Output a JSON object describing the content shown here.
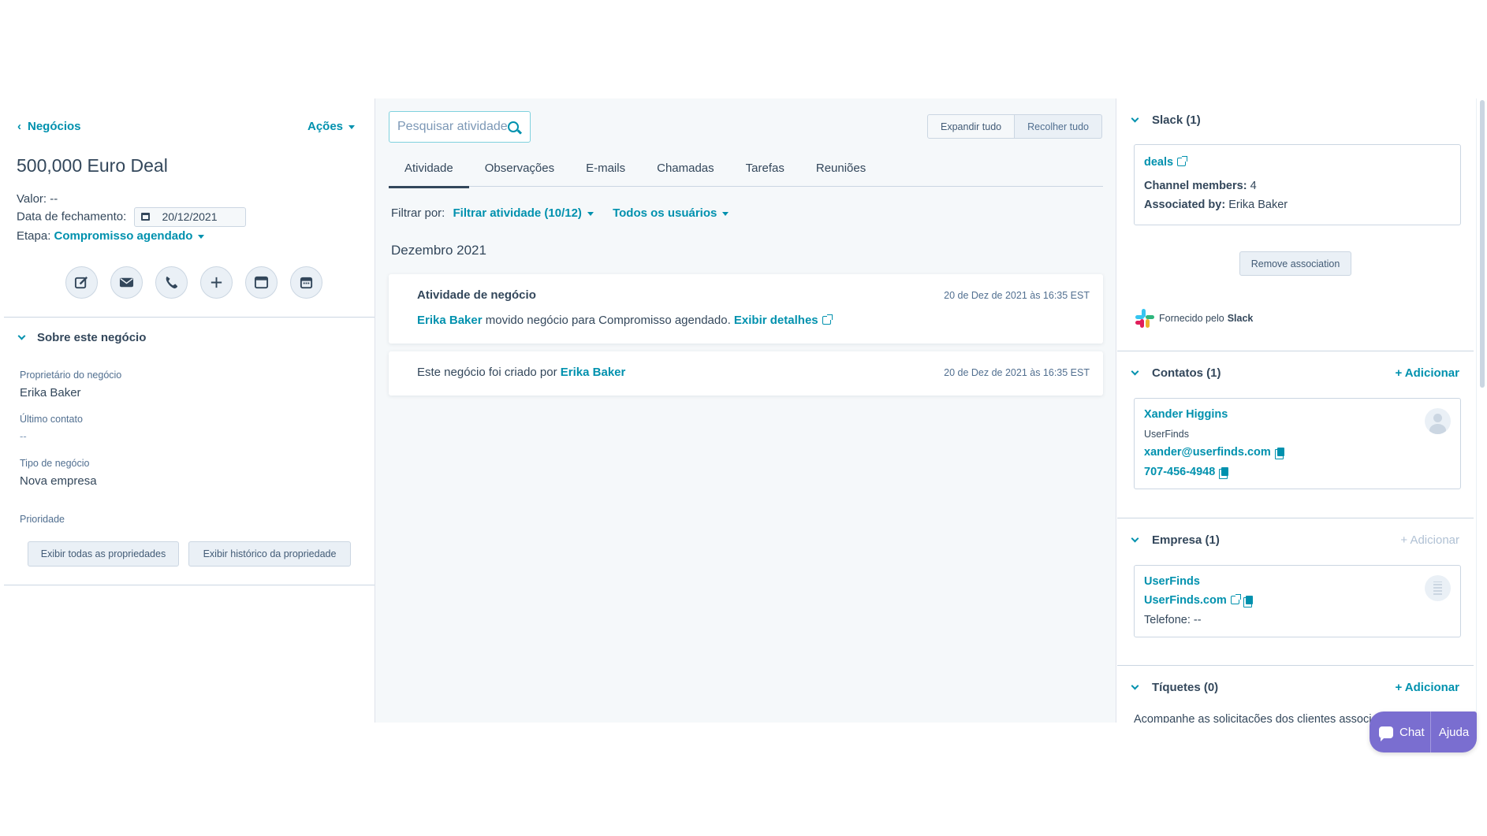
{
  "left": {
    "back_label": "Negócios",
    "actions_label": "Ações",
    "deal_title": "500,000 Euro Deal",
    "valor_label": "Valor:",
    "valor_value": "--",
    "close_date_label": "Data de fechamento:",
    "close_date_value": "20/12/2021",
    "stage_label": "Etapa:",
    "stage_value": "Compromisso agendado",
    "about_heading": "Sobre este negócio",
    "props": [
      {
        "label": "Proprietário do negócio",
        "value": "Erika Baker"
      },
      {
        "label": "Último contato",
        "value": "--"
      },
      {
        "label": "Tipo de negócio",
        "value": "Nova empresa"
      },
      {
        "label": "Prioridade",
        "value": ""
      }
    ],
    "view_all_props": "Exibir todas as propriedades",
    "view_prop_history": "Exibir histórico da propriedade"
  },
  "mid": {
    "search_placeholder": "Pesquisar atividade",
    "expand_all": "Expandir tudo",
    "collapse_all": "Recolher tudo",
    "tabs": [
      "Atividade",
      "Observações",
      "E-mails",
      "Chamadas",
      "Tarefas",
      "Reuniões"
    ],
    "filter_label": "Filtrar por:",
    "filter_activity": "Filtrar atividade (10/12)",
    "filter_users": "Todos os usuários",
    "month": "Dezembro 2021",
    "card1": {
      "title": "Atividade de negócio",
      "timestamp": "20 de Dez de 2021 às 16:35 EST",
      "user": "Erika Baker",
      "text": "movido negócio para Compromisso agendado.",
      "details_link": "Exibir detalhes"
    },
    "card2": {
      "text": "Este negócio foi criado por",
      "user": "Erika Baker",
      "timestamp": "20 de Dez de 2021 às 16:35 EST"
    }
  },
  "right": {
    "slack": {
      "heading": "Slack (1)",
      "channel": "deals",
      "members_label": "Channel members:",
      "members_value": "4",
      "assoc_label": "Associated by:",
      "assoc_value": "Erika Baker",
      "remove_button": "Remove association",
      "powered_prefix": "Fornecido pelo",
      "powered_brand": "Slack"
    },
    "contacts": {
      "heading": "Contatos (1)",
      "add": "+ Adicionar",
      "name": "Xander Higgins",
      "company": "UserFinds",
      "email": "xander@userfinds.com",
      "phone": "707-456-4948"
    },
    "company": {
      "heading": "Empresa (1)",
      "add": "+ Adicionar",
      "name": "UserFinds",
      "domain": "UserFinds.com",
      "phone_label": "Telefone:",
      "phone_value": "--"
    },
    "tickets": {
      "heading": "Tíquetes (0)",
      "add": "+ Adicionar",
      "text": "Acompanhe as solicitações dos clientes associa"
    }
  },
  "chat": {
    "chat_label": "Chat",
    "help_label": "Ajuda"
  },
  "colors": {
    "link": "#0091ae",
    "text": "#33475b",
    "panel_bg": "#f5f8fa",
    "chat_bg": "#7a6ed0"
  }
}
